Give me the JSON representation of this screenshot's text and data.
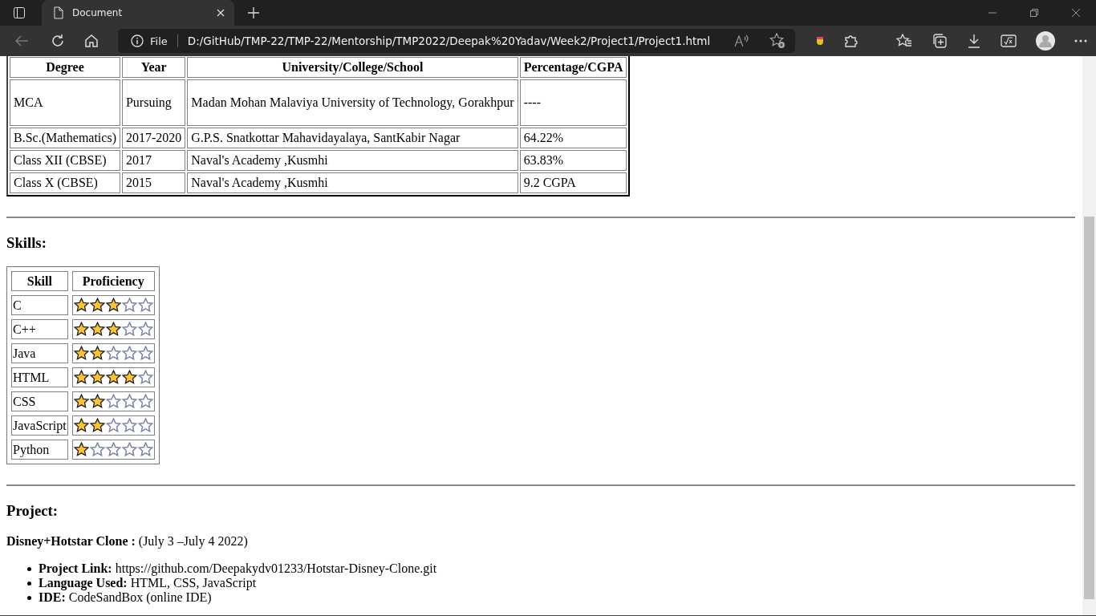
{
  "browser": {
    "tab_title": "Document",
    "address_label": "File",
    "url": "D:/GitHub/TMP-22/TMP-22/Mentorship/TMP2022/Deepak%20Yadav/Week2/Project1/Project1.html"
  },
  "education": {
    "columns": [
      "Degree",
      "Year",
      "University/College/School",
      "Percentage/CGPA"
    ],
    "rows": [
      [
        "MCA",
        "Pursuing",
        "Madan Mohan Malaviya University of Technology, Gorakhpur",
        "----"
      ],
      [
        "B.Sc.(Mathematics)",
        "2017-2020",
        "G.P.S. Snatkottar Mahavidayalaya, SantKabir Nagar",
        "64.22%"
      ],
      [
        "Class XII (CBSE)",
        "2017",
        "Naval's Academy ,Kusmhi",
        "63.83%"
      ],
      [
        "Class X (CBSE)",
        "2015",
        "Naval's Academy ,Kusmhi",
        "9.2 CGPA"
      ]
    ]
  },
  "skills": {
    "heading": "Skills:",
    "columns": [
      "Skill",
      "Proficiency"
    ],
    "rows": [
      {
        "skill": "C",
        "stars": 3
      },
      {
        "skill": "C++",
        "stars": 3
      },
      {
        "skill": "Java",
        "stars": 2
      },
      {
        "skill": "HTML",
        "stars": 4
      },
      {
        "skill": "CSS",
        "stars": 2
      },
      {
        "skill": "JavaScript",
        "stars": 2
      },
      {
        "skill": "Python",
        "stars": 1
      }
    ]
  },
  "project": {
    "heading": "Project:",
    "title": "**Disney+Hotstar Clone :** (July 3 –July 4 2022)",
    "details": [
      "**Project Link:** https://github.com/Deepakydv01233/Hotstar-Disney-Clone.git",
      "**Language Used:** HTML, CSS, JavaScript",
      "**IDE:** CodeSandBox (online IDE)"
    ]
  }
}
